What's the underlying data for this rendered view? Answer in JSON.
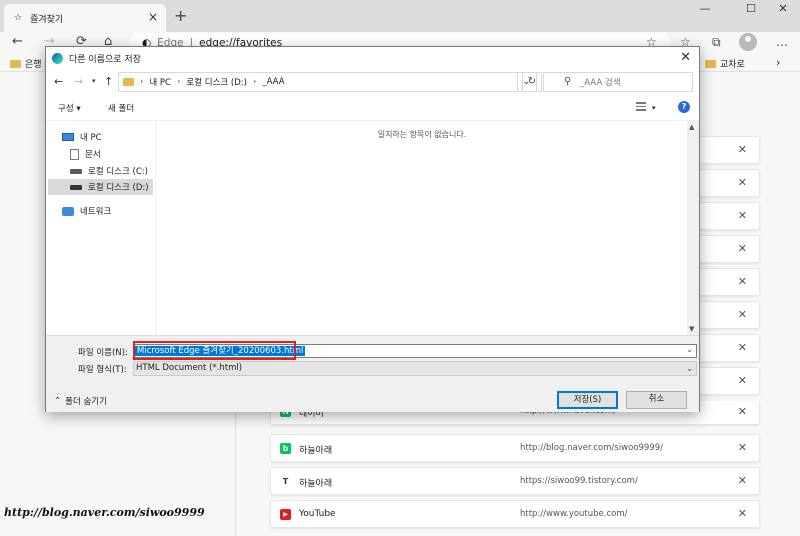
{
  "browser": {
    "tab_title": "즐겨찾기",
    "address_host": "Edge",
    "address_sep": "|",
    "address_path": "edge://favorites",
    "favbar_items": [
      "은행",
      "교차로"
    ]
  },
  "favorites": [
    {
      "name": "네이버",
      "url": "http://www.naver.com/",
      "icon_color": "#03c75a",
      "icon_glyph": "N"
    },
    {
      "name": "하늘아래",
      "url": "http://blog.naver.com/siwoo9999/",
      "icon_color": "#03c75a",
      "icon_glyph": "b"
    },
    {
      "name": "하늘아래",
      "url": "https://siwoo99.tistory.com/",
      "icon_color": "#333333",
      "icon_glyph": "T"
    },
    {
      "name": "YouTube",
      "url": "http://www.youtube.com/",
      "icon_color": "#e02020",
      "icon_glyph": "▶"
    }
  ],
  "watermark": "http://blog.naver.com/siwoo9999",
  "dialog": {
    "title": "다른 이름으로 저장",
    "path": [
      "내 PC",
      "로컬 디스크 (D:)",
      "_AAA"
    ],
    "search_placeholder": "_AAA 검색",
    "organize": "구성",
    "new_folder": "새 폴더",
    "nav_items": [
      {
        "label": "내 PC",
        "icon": "pc-icon"
      },
      {
        "label": "문서",
        "icon": "document-icon"
      },
      {
        "label": "로컬 디스크 (C:)",
        "icon": "drive-icon"
      },
      {
        "label": "로컬 디스크 (D:)",
        "icon": "drive-icon",
        "selected": true
      },
      {
        "label": "네트워크",
        "icon": "network-icon"
      }
    ],
    "empty_message": "일치하는 항목이 없습니다.",
    "filename_label": "파일 이름(N):",
    "filename_value": "Microsoft Edge 즐겨찾기_20200603.html",
    "filetype_label": "파일 형식(T):",
    "filetype_value": "HTML Document (*.html)",
    "hide_folders": "폴더 숨기기",
    "save_button": "저장(S)",
    "cancel_button": "취소"
  }
}
